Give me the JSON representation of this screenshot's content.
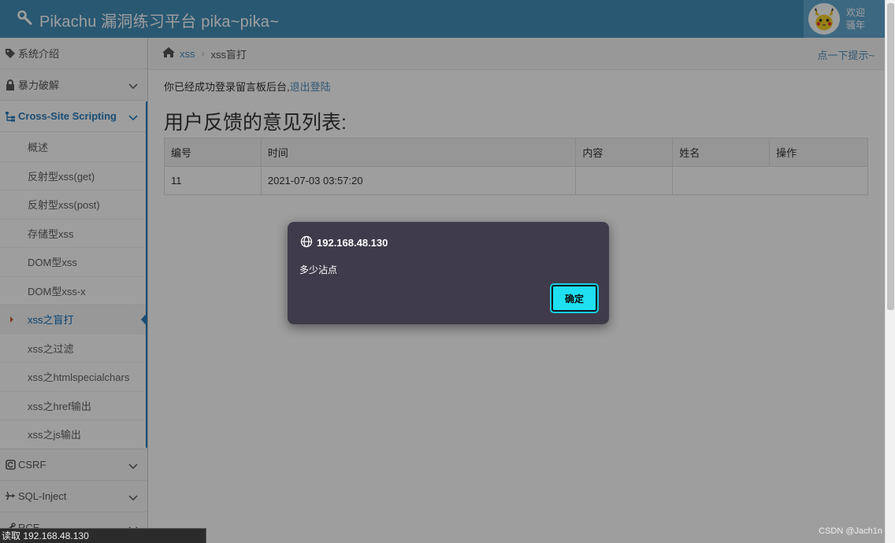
{
  "navbar": {
    "title": "Pikachu 漏洞练习平台 pika~pika~",
    "icon": "wrench-icon",
    "user_greeting_1": "欢迎",
    "user_greeting_2": "骚年"
  },
  "breadcrumb": {
    "home_icon": "home-icon",
    "link": "xss",
    "current": "xss盲打",
    "hint": "点一下提示~"
  },
  "sidebar": {
    "items": [
      {
        "label": "系统介绍",
        "icon": "tags-icon"
      },
      {
        "label": "暴力破解",
        "icon": "lock-icon"
      },
      {
        "label": "Cross-Site Scripting",
        "icon": "sitemap-icon"
      },
      {
        "label": "CSRF",
        "icon": "refresh-icon"
      },
      {
        "label": "SQL-Inject",
        "icon": "plane-icon"
      },
      {
        "label": "RCE",
        "icon": "wrench-icon"
      }
    ],
    "xss_sub": [
      "概述",
      "反射型xss(get)",
      "反射型xss(post)",
      "存储型xss",
      "DOM型xss",
      "DOM型xss-x",
      "xss之盲打",
      "xss之过滤",
      "xss之htmlspecialchars",
      "xss之href输出",
      "xss之js输出"
    ]
  },
  "main": {
    "login_prefix": "你已经成功登录留言板后台,",
    "logout_link": "退出登陆",
    "list_title": "用户反馈的意见列表:",
    "table": {
      "headers": [
        "编号",
        "时间",
        "内容",
        "姓名",
        "操作"
      ],
      "rows": [
        [
          "11",
          "2021-07-03 03:57:20",
          "",
          "",
          ""
        ]
      ]
    }
  },
  "dialog": {
    "host": "192.168.48.130",
    "message": "多少沾点",
    "ok_label": "确定",
    "accent": "#1ee0f0"
  },
  "statusbar": {
    "text": "读取 192.168.48.130"
  },
  "watermark": "CSDN @Jach1n"
}
